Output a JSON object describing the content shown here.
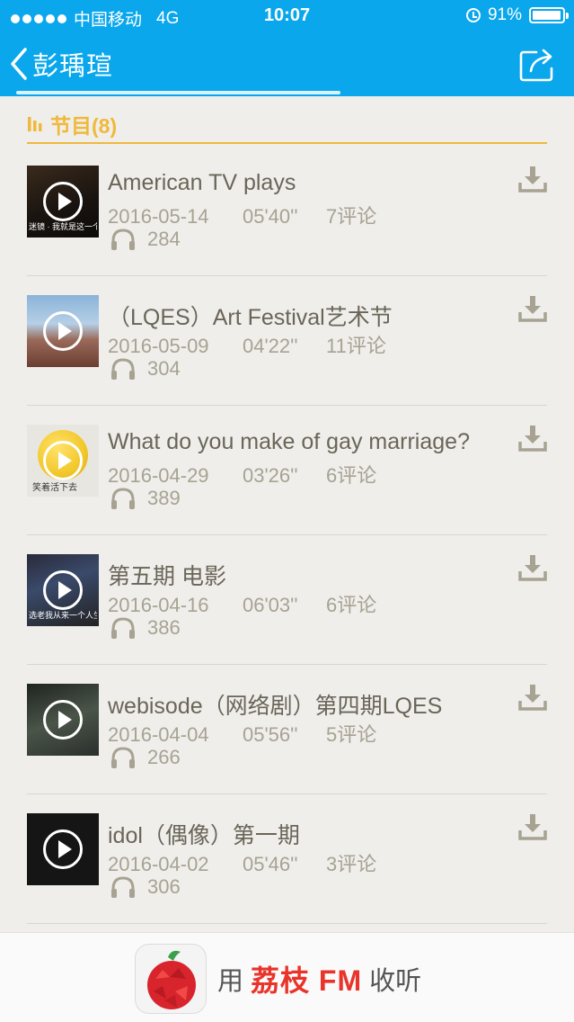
{
  "status_bar": {
    "carrier": "中国移动",
    "network": "4G",
    "time": "10:07",
    "battery": "91%"
  },
  "nav": {
    "title": "彭瑀瑄"
  },
  "section": {
    "title": "节目(8)"
  },
  "items": [
    {
      "title": "American TV plays",
      "date": "2016-05-14",
      "duration": "05'40''",
      "comments": "7评论",
      "plays": "284",
      "thumb_caption": "迷镜 · 我就是这一个人"
    },
    {
      "title": "（LQES）Art Festival艺术节",
      "date": "2016-05-09",
      "duration": "04'22''",
      "comments": "11评论",
      "plays": "304",
      "thumb_caption": ""
    },
    {
      "title": "What do you make of gay marriage?",
      "date": "2016-04-29",
      "duration": "03'26''",
      "comments": "6评论",
      "plays": "389",
      "thumb_caption": "笑着活下去"
    },
    {
      "title": "第五期 电影",
      "date": "2016-04-16",
      "duration": "06'03''",
      "comments": "6评论",
      "plays": "386",
      "thumb_caption": "选老我从来一个人生活"
    },
    {
      "title": "webisode（网络剧）第四期LQES",
      "date": "2016-04-04",
      "duration": "05'56''",
      "comments": "5评论",
      "plays": "266",
      "thumb_caption": ""
    },
    {
      "title": "idol（偶像）第一期",
      "date": "2016-04-02",
      "duration": "05'46''",
      "comments": "3评论",
      "plays": "306",
      "thumb_caption": ""
    }
  ],
  "banner": {
    "prefix": "用",
    "brand": "荔枝 FM",
    "suffix": "收听"
  },
  "colors": {
    "header": "#0aa7ec",
    "accent": "#f0b93c",
    "brand": "#e8342a"
  }
}
